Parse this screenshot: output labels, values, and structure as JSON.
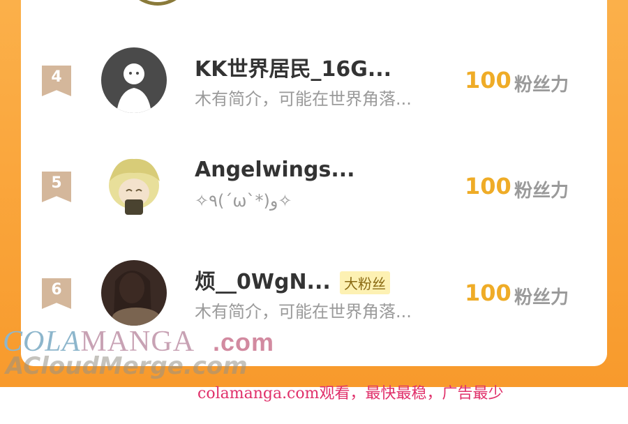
{
  "ranking": [
    {
      "rank": "4",
      "name": "KK世界居民_16G...",
      "description": "木有简介，可能在世界角落...",
      "score": "100",
      "unit": "粉丝力",
      "badge": ""
    },
    {
      "rank": "5",
      "name": "Angelwings...",
      "description": "✧٩(ˊωˋ*)و✧",
      "score": "100",
      "unit": "粉丝力",
      "badge": ""
    },
    {
      "rank": "6",
      "name": "烦__0WgN...",
      "description": "木有简介，可能在世界角落...",
      "score": "100",
      "unit": "粉丝力",
      "badge": "大粉丝"
    }
  ],
  "watermark": {
    "part1": "COLA",
    "part2": "MANGA",
    "part3": ".com",
    "line2": "ACloudMerge.com"
  },
  "footer_text": "colamanga.com观看，最快最稳，广告最少",
  "colors": {
    "accent_orange": "#f89a2c",
    "score_gold": "#efac27",
    "rank_badge": "#d4b79b",
    "footer_pink": "#e0306a"
  }
}
